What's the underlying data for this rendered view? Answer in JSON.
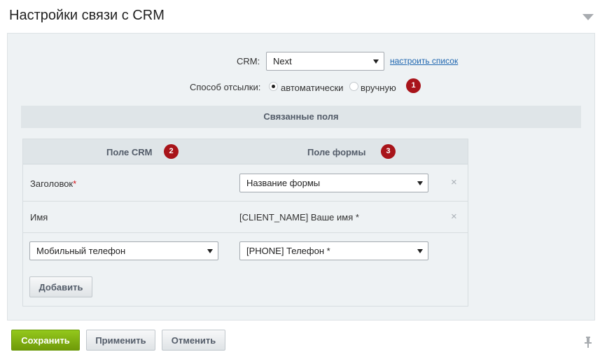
{
  "header": {
    "title": "Настройки связи с CRM"
  },
  "crm": {
    "label": "CRM:",
    "selected": "Next",
    "configure_link": "настроить список"
  },
  "send_method": {
    "label": "Способ отсылки:",
    "options": [
      {
        "label": "автоматически",
        "checked": true
      },
      {
        "label": "вручную",
        "checked": false
      }
    ],
    "badge": "1"
  },
  "linked_fields": {
    "title": "Связанные поля",
    "col_crm": "Поле CRM",
    "col_crm_badge": "2",
    "col_form": "Поле формы",
    "col_form_badge": "3",
    "rows": [
      {
        "crm_field": "Заголовок",
        "required_mark": "*",
        "form_field": "Название формы",
        "delete": "×"
      },
      {
        "crm_field": "Имя",
        "form_field": "[CLIENT_NAME] Ваше имя *",
        "delete": "×"
      }
    ],
    "new_row": {
      "crm_select": "Мобильный телефон",
      "form_select": "[PHONE] Телефон *"
    },
    "add_button": "Добавить"
  },
  "footer": {
    "save": "Сохранить",
    "apply": "Применить",
    "cancel": "Отменить"
  },
  "colors": {
    "badge": "#a8141a",
    "save_button": "#7ba713",
    "link": "#2067b0"
  },
  "icons": [
    "chevron-down-icon",
    "pin-icon",
    "close-icon"
  ]
}
